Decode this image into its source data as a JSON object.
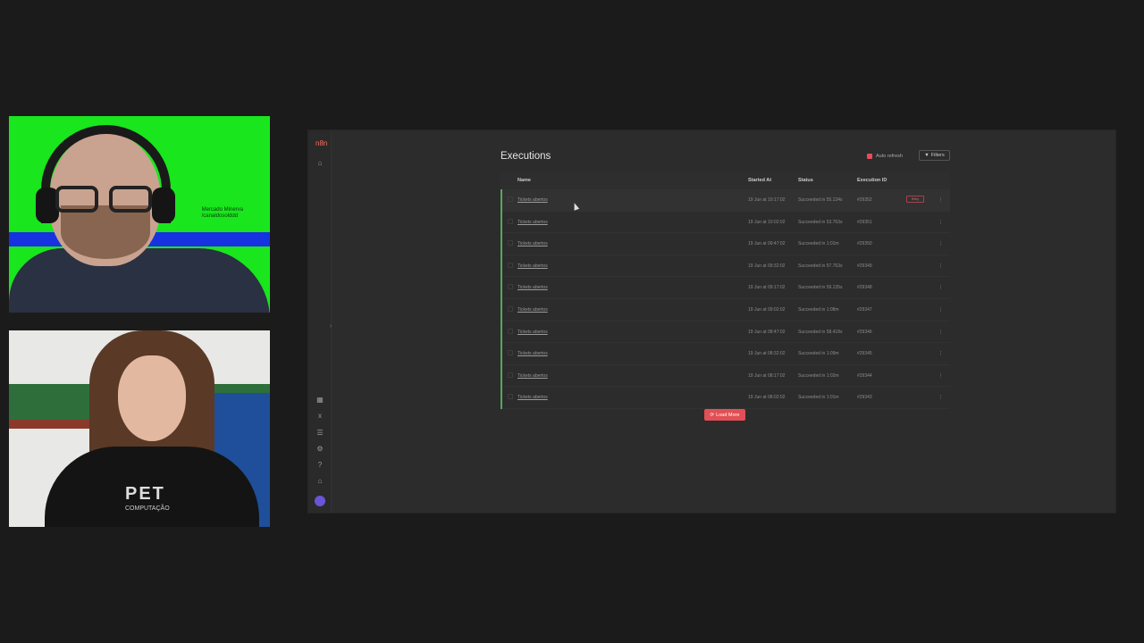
{
  "webcam": {
    "top_badge_line1": "Mercado Minerva",
    "top_badge_line2": "/canaldosolddd",
    "shirt_text": "PET",
    "shirt_subtext": "COMPUTAÇÃO"
  },
  "sidebar": {
    "logo": "n8n",
    "icons": [
      "home-icon",
      "templates-icon",
      "variables-icon",
      "executions-icon",
      "settings-icon",
      "help-icon",
      "whats-new-icon",
      "user-avatar-icon"
    ]
  },
  "executions": {
    "title": "Executions",
    "auto_refresh_label": "Auto refresh",
    "filters_label": "Filters",
    "columns": {
      "name": "Name",
      "started_at": "Started At",
      "status": "Status",
      "execution_id": "Execution ID"
    },
    "rows": [
      {
        "name": "Tickets abertos",
        "started": "19 Jun at 10:17:02",
        "status": "Succeeded in 55.134s",
        "id": "#29352",
        "retry": "Retry"
      },
      {
        "name": "Tickets abertos",
        "started": "19 Jun at 10:02:02",
        "status": "Succeeded in 53.763s",
        "id": "#29351"
      },
      {
        "name": "Tickets abertos",
        "started": "19 Jun at 09:47:02",
        "status": "Succeeded in 1:01m",
        "id": "#29350"
      },
      {
        "name": "Tickets abertos",
        "started": "19 Jun at 09:32:02",
        "status": "Succeeded in 57.763s",
        "id": "#29349"
      },
      {
        "name": "Tickets abertos",
        "started": "19 Jun at 09:17:02",
        "status": "Succeeded in 59.135s",
        "id": "#29348"
      },
      {
        "name": "Tickets abertos",
        "started": "19 Jun at 09:02:02",
        "status": "Succeeded in 1:08m",
        "id": "#29347"
      },
      {
        "name": "Tickets abertos",
        "started": "19 Jun at 08:47:02",
        "status": "Succeeded in 58.418s",
        "id": "#29346"
      },
      {
        "name": "Tickets abertos",
        "started": "19 Jun at 08:32:02",
        "status": "Succeeded in 1:09m",
        "id": "#29345"
      },
      {
        "name": "Tickets abertos",
        "started": "19 Jun at 08:17:02",
        "status": "Succeeded in 1:02m",
        "id": "#29344"
      },
      {
        "name": "Tickets abertos",
        "started": "19 Jun at 08:02:02",
        "status": "Succeeded in 1:01m",
        "id": "#29343"
      }
    ],
    "load_more_label": "Load More"
  },
  "colors": {
    "accent": "#e24f56",
    "success_bar": "#58a85a",
    "window_bg": "#2c2c2c"
  }
}
